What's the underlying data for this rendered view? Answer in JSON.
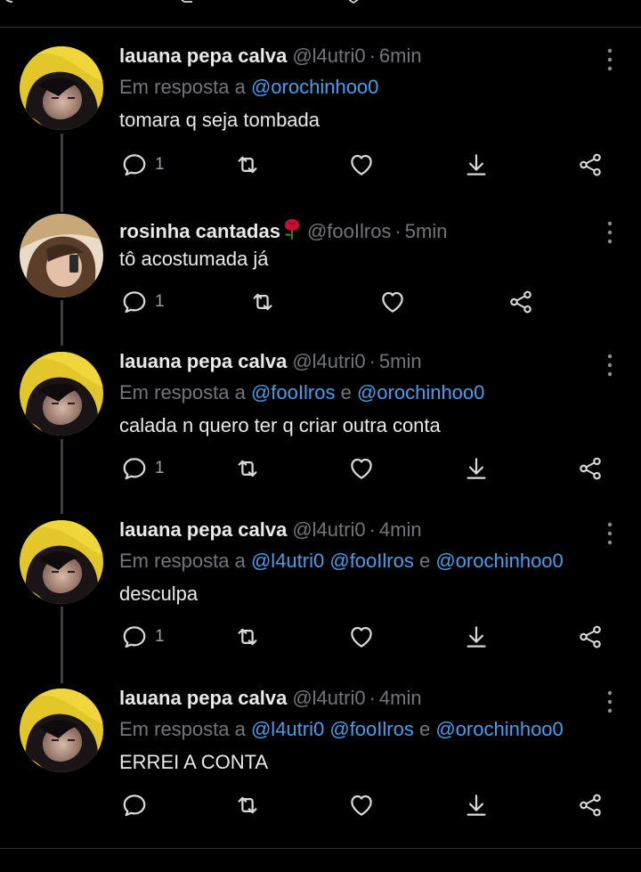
{
  "reply_prefix": "Em resposta a",
  "tweets": [
    {
      "name": "lauana pepa calva",
      "handle": "@l4utri0",
      "time": "6min",
      "reply_to": [
        "@orochinhoo0"
      ],
      "reply_join": "",
      "text": "tomara q seja tombada",
      "reply_count": "1"
    },
    {
      "name": "rosinha cantadas",
      "emoji": "rose",
      "handle": "@fooIlros",
      "time": "5min",
      "text": "tô acostumada já",
      "reply_count": "1"
    },
    {
      "name": "lauana pepa calva",
      "handle": "@l4utri0",
      "time": "5min",
      "reply_to": [
        "@fooIlros",
        "@orochinhoo0"
      ],
      "reply_join": "e",
      "text": "calada n quero ter q criar outra conta",
      "reply_count": "1"
    },
    {
      "name": "lauana pepa calva",
      "handle": "@l4utri0",
      "time": "4min",
      "reply_to": [
        "@l4utri0",
        "@fooIlros",
        "@orochinhoo0"
      ],
      "reply_join": "e",
      "text": "desculpa",
      "reply_count": "1"
    },
    {
      "name": "lauana pepa calva",
      "handle": "@l4utri0",
      "time": "4min",
      "reply_to": [
        "@l4utri0",
        "@fooIlros",
        "@orochinhoo0"
      ],
      "reply_join": "e",
      "text": "ERREI A CONTA",
      "reply_count": ""
    }
  ],
  "colors": {
    "background": "#000000",
    "text": "#e7e9ea",
    "muted": "#71767b",
    "mention": "#4a9dec",
    "icon": "#d9d9d9",
    "divider": "#2f3336"
  },
  "icons": [
    "reply-icon",
    "retweet-icon",
    "like-icon",
    "download-icon",
    "share-icon",
    "more-icon",
    "rose-icon"
  ]
}
